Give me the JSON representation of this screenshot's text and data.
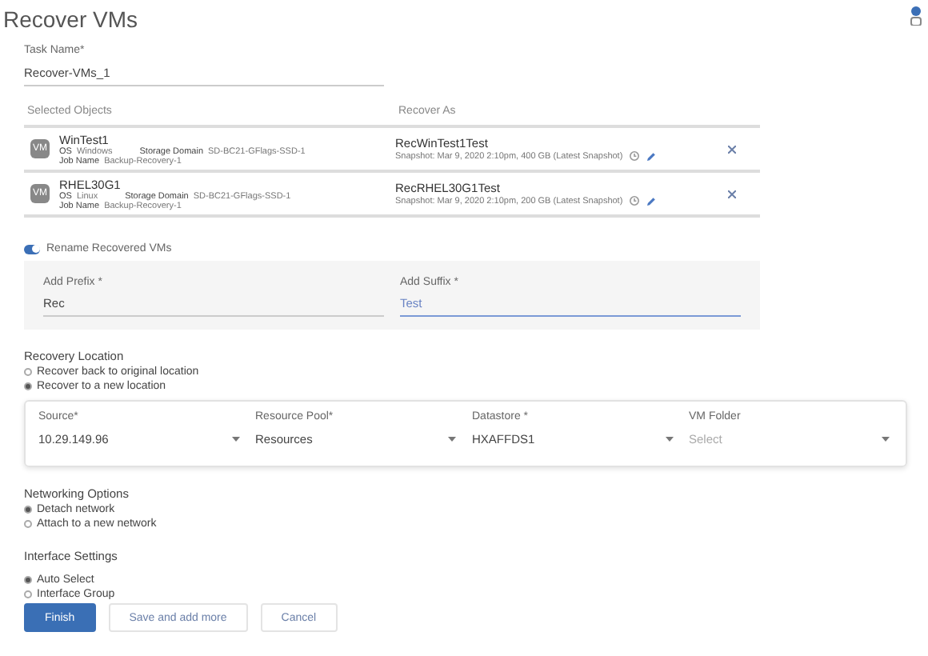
{
  "title": "Recover VMs",
  "task_name": {
    "label": "Task Name*",
    "value": "Recover-VMs_1"
  },
  "objects_table": {
    "columns": [
      "Selected Objects",
      "Recover As"
    ],
    "rows": [
      {
        "badge": "VM",
        "name": "WinTest1",
        "os_label": "OS",
        "os": "Windows",
        "domain_label": "Storage Domain",
        "domain": "SD-BC21-GFlags-SSD-1",
        "job_label": "Job Name",
        "job": "Backup-Recovery-1",
        "recover_name": "RecWinTest1Test",
        "snapshot": "Snapshot: Mar 9, 2020 2:10pm, 400 GB (Latest Snapshot)"
      },
      {
        "badge": "VM",
        "name": "RHEL30G1",
        "os_label": "OS",
        "os": "Linux",
        "domain_label": "Storage Domain",
        "domain": "SD-BC21-GFlags-SSD-1",
        "job_label": "Job Name",
        "job": "Backup-Recovery-1",
        "recover_name": "RecRHEL30G1Test",
        "snapshot": "Snapshot: Mar 9, 2020 2:10pm, 200 GB (Latest Snapshot)"
      }
    ]
  },
  "rename": {
    "label": "Rename Recovered VMs",
    "on": true,
    "fields": [
      {
        "label": "Add Prefix *",
        "value": "Rec",
        "focused": false
      },
      {
        "label": "Add Suffix *",
        "value": "Test",
        "focused": true
      }
    ]
  },
  "recovery_location": {
    "title": "Recovery Location",
    "options": [
      {
        "label": "Recover back to original location",
        "selected": false
      },
      {
        "label": "Recover to a new location",
        "selected": true
      }
    ]
  },
  "location_fields": [
    {
      "label": "Source*",
      "value": "10.29.149.96"
    },
    {
      "label": "Resource Pool*",
      "value": "Resources"
    },
    {
      "label": "Datastore *",
      "value": "HXAFFDS1"
    },
    {
      "label": "VM Folder",
      "placeholder": "Select"
    }
  ],
  "networking": {
    "title": "Networking Options",
    "options": [
      {
        "label": "Detach network",
        "selected": true
      },
      {
        "label": "Attach to a new network",
        "selected": false
      }
    ]
  },
  "interface": {
    "title": "Interface Settings",
    "options": [
      {
        "label": "Auto Select",
        "selected": true
      },
      {
        "label": "Interface Group",
        "selected": false
      }
    ]
  },
  "buttons": [
    {
      "label": "Finish",
      "kind": "primary"
    },
    {
      "label": "Save and add more",
      "kind": "secondary"
    },
    {
      "label": "Cancel",
      "kind": "secondary"
    }
  ]
}
